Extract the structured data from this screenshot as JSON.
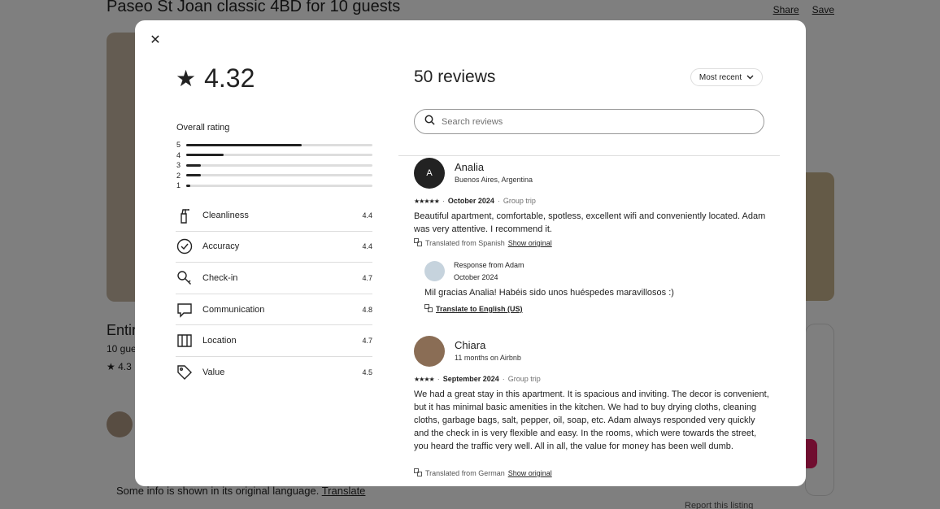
{
  "background": {
    "title": "Paseo St Joan classic 4BD for 10 guests",
    "share_label": "Share",
    "save_label": "Save",
    "entire_label": "Entir",
    "guests_label": "10 gue",
    "rating_label": "★ 4.3",
    "notice_text": "Some info is shown in its original language.",
    "translate_label": "Translate",
    "report_label": "Report this listing"
  },
  "modal": {
    "close_icon": "close-icon",
    "rating_value": "4.32",
    "overall_label": "Overall rating",
    "distribution": [
      {
        "label": "5",
        "fraction": 0.62
      },
      {
        "label": "4",
        "fraction": 0.2
      },
      {
        "label": "3",
        "fraction": 0.08
      },
      {
        "label": "2",
        "fraction": 0.08
      },
      {
        "label": "1",
        "fraction": 0.02
      }
    ],
    "categories": [
      {
        "label": "Cleanliness",
        "value": "4.4",
        "icon": "spray-bottle-icon"
      },
      {
        "label": "Accuracy",
        "value": "4.4",
        "icon": "check-circle-icon"
      },
      {
        "label": "Check-in",
        "value": "4.7",
        "icon": "key-icon"
      },
      {
        "label": "Communication",
        "value": "4.8",
        "icon": "chat-bubble-icon"
      },
      {
        "label": "Location",
        "value": "4.7",
        "icon": "map-icon"
      },
      {
        "label": "Value",
        "value": "4.5",
        "icon": "tag-icon"
      }
    ],
    "reviews_title": "50 reviews",
    "sort_label": "Most recent",
    "search_placeholder": "Search reviews",
    "reviews": [
      {
        "name": "Analia",
        "sub": "Buenos Aires, Argentina",
        "initial": "A",
        "stars": "★★★★★",
        "date": "October 2024",
        "trip": "Group trip",
        "text": "Beautiful apartment, comfortable, spotless, excellent wifi and conveniently located. Adam was very attentive. I recommend it.",
        "translated": "Translated from Spanish",
        "show_original": "Show original",
        "response": {
          "title": "Response from Adam",
          "date": "October 2024",
          "text": "Mil gracias Analia! Habéis sido unos huéspedes maravillosos :)",
          "translate": "Translate to English (US)"
        }
      },
      {
        "name": "Chiara",
        "sub": "11 months on Airbnb",
        "stars": "★★★★",
        "date": "September 2024",
        "trip": "Group trip",
        "text": "We had a great stay in this apartment. It is spacious and inviting. The decor is convenient, but it has minimal basic amenities in the kitchen. We had to buy drying cloths, cleaning cloths, garbage bags, salt, pepper, oil, soap, etc. Adam always responded very quickly and the check in is very flexible and easy. In the rooms, which were towards the street, you heard the traffic very well. All in all, the value for money has been well dumb.",
        "translated": "Translated from German",
        "show_original": "Show original"
      }
    ]
  }
}
